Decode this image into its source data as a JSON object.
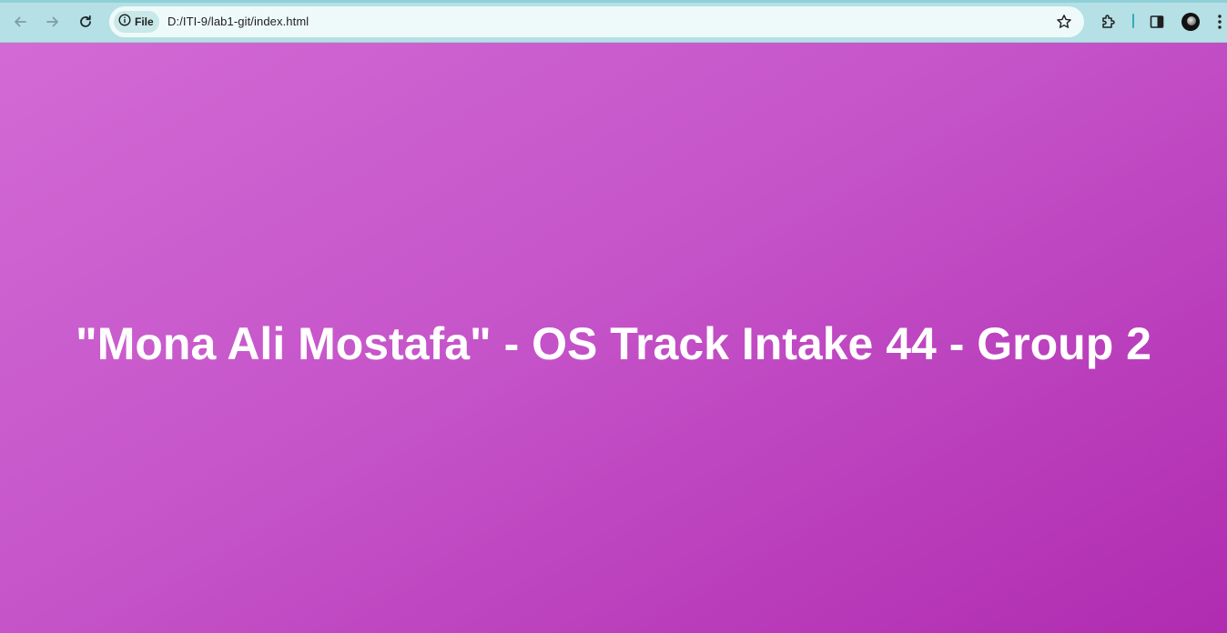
{
  "browser": {
    "address_bar": {
      "security_chip_label": "File",
      "url": "D:/ITI-9/lab1-git/index.html"
    }
  },
  "page": {
    "heading": "\"Mona Ali Mostafa\" - OS Track Intake 44 - Group 2"
  },
  "colors": {
    "toolbar_background": "#b5e0e5",
    "page_gradient_start": "#d26ad4",
    "page_gradient_end": "#b02bb0",
    "heading_text": "#ffffff"
  },
  "icons": {
    "back": "back-arrow-icon",
    "forward": "forward-arrow-icon",
    "reload": "reload-icon",
    "site_info": "info-icon",
    "bookmark": "star-icon",
    "extensions": "puzzle-icon",
    "side_panel": "side-panel-icon",
    "profile": "avatar",
    "menu": "kebab-menu-icon"
  }
}
